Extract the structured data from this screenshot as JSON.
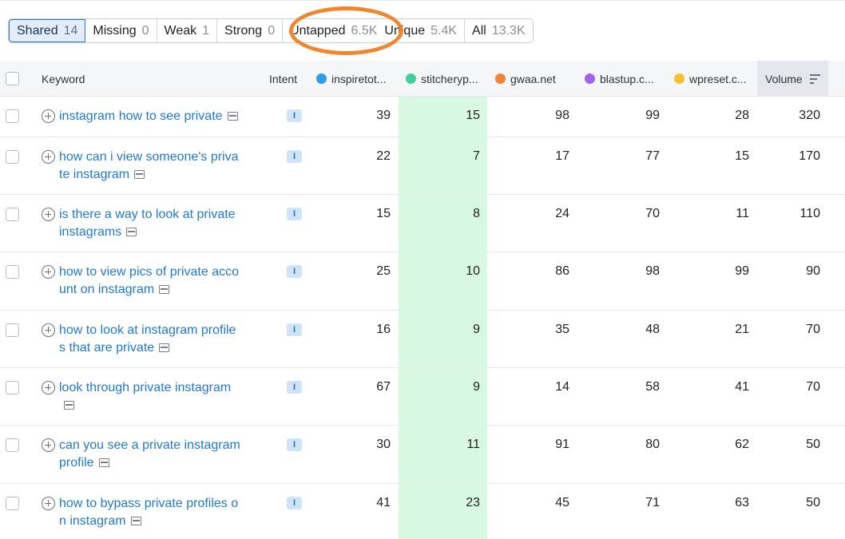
{
  "tabs": [
    {
      "label": "Shared",
      "count": "14"
    },
    {
      "label": "Missing",
      "count": "0"
    },
    {
      "label": "Weak",
      "count": "1"
    },
    {
      "label": "Strong",
      "count": "0"
    },
    {
      "label": "Untapped",
      "count": "6.5K"
    },
    {
      "label": "Unique",
      "count": "5.4K"
    },
    {
      "label": "All",
      "count": "13.3K"
    }
  ],
  "columns": {
    "keyword": "Keyword",
    "intent": "Intent",
    "domains": [
      {
        "label": "inspiretot...",
        "color": "#2e9cf0"
      },
      {
        "label": "stitcheryp...",
        "color": "#3fd09a"
      },
      {
        "label": "gwaa.net",
        "color": "#f5813a"
      },
      {
        "label": "blastup.c...",
        "color": "#a65ff0"
      },
      {
        "label": "wpreset.c...",
        "color": "#f5c030"
      }
    ],
    "volume": "Volume"
  },
  "rows": [
    {
      "keyword": "instagram how to see private",
      "intent": "I",
      "values": [
        "39",
        "15",
        "98",
        "99",
        "28"
      ],
      "volume": "320"
    },
    {
      "keyword": "how can i view someone's private instagram",
      "intent": "I",
      "values": [
        "22",
        "7",
        "17",
        "77",
        "15"
      ],
      "volume": "170"
    },
    {
      "keyword": "is there a way to look at private instagrams",
      "intent": "I",
      "values": [
        "15",
        "8",
        "24",
        "70",
        "11"
      ],
      "volume": "110"
    },
    {
      "keyword": "how to view pics of private account on instagram",
      "intent": "I",
      "values": [
        "25",
        "10",
        "86",
        "98",
        "99"
      ],
      "volume": "90"
    },
    {
      "keyword": "how to look at instagram profiles that are private",
      "intent": "I",
      "values": [
        "16",
        "9",
        "35",
        "48",
        "21"
      ],
      "volume": "70"
    },
    {
      "keyword": "look through private instagram",
      "intent": "I",
      "values": [
        "67",
        "9",
        "14",
        "58",
        "41"
      ],
      "volume": "70"
    },
    {
      "keyword": "can you see a private instagram profile",
      "intent": "I",
      "values": [
        "30",
        "11",
        "91",
        "80",
        "62"
      ],
      "volume": "50"
    },
    {
      "keyword": "how to bypass private profiles on instagram",
      "intent": "I",
      "values": [
        "41",
        "23",
        "45",
        "71",
        "63"
      ],
      "volume": "50"
    }
  ]
}
